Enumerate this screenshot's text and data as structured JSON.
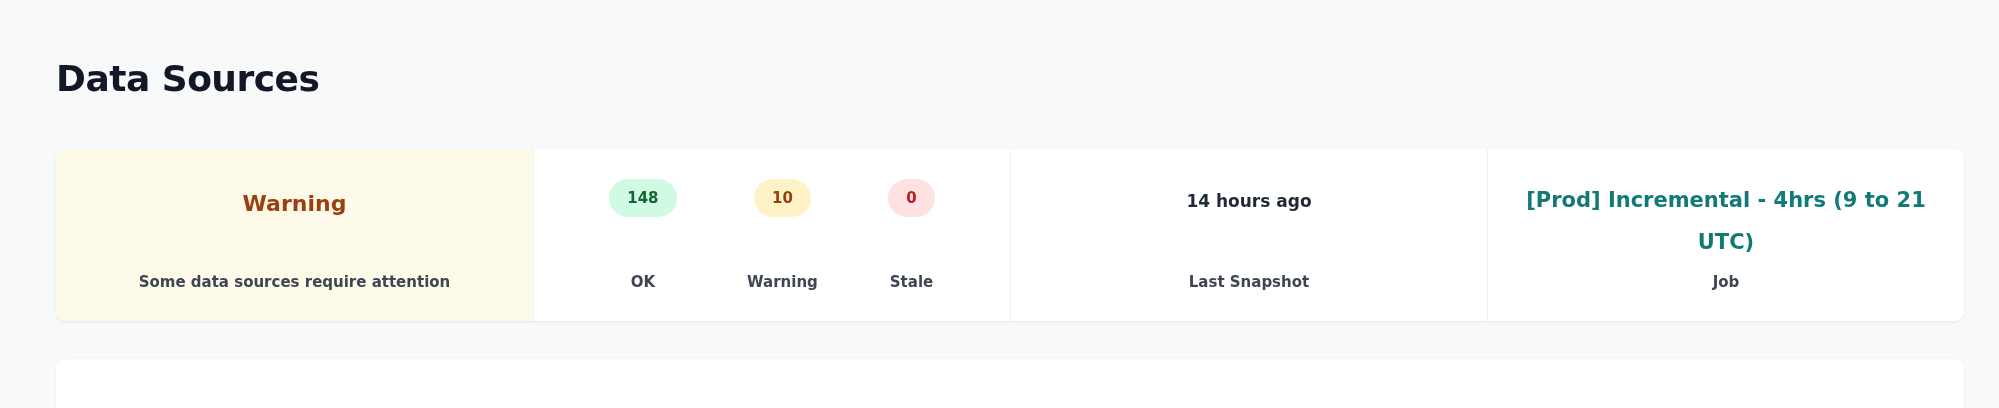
{
  "page": {
    "title": "Data Sources"
  },
  "summary": {
    "status": {
      "kind": "warning",
      "label": "Warning",
      "message": "Some data sources require attention"
    },
    "counts": [
      {
        "kind": "ok",
        "value": "148",
        "label": "OK"
      },
      {
        "kind": "warning",
        "value": "10",
        "label": "Warning"
      },
      {
        "kind": "stale",
        "value": "0",
        "label": "Stale"
      }
    ],
    "last_snapshot": {
      "value": "14 hours ago",
      "label": "Last Snapshot"
    },
    "job": {
      "value": "[Prod] Incremental - 4hrs (9 to 21 UTC)",
      "label": "Job"
    }
  }
}
